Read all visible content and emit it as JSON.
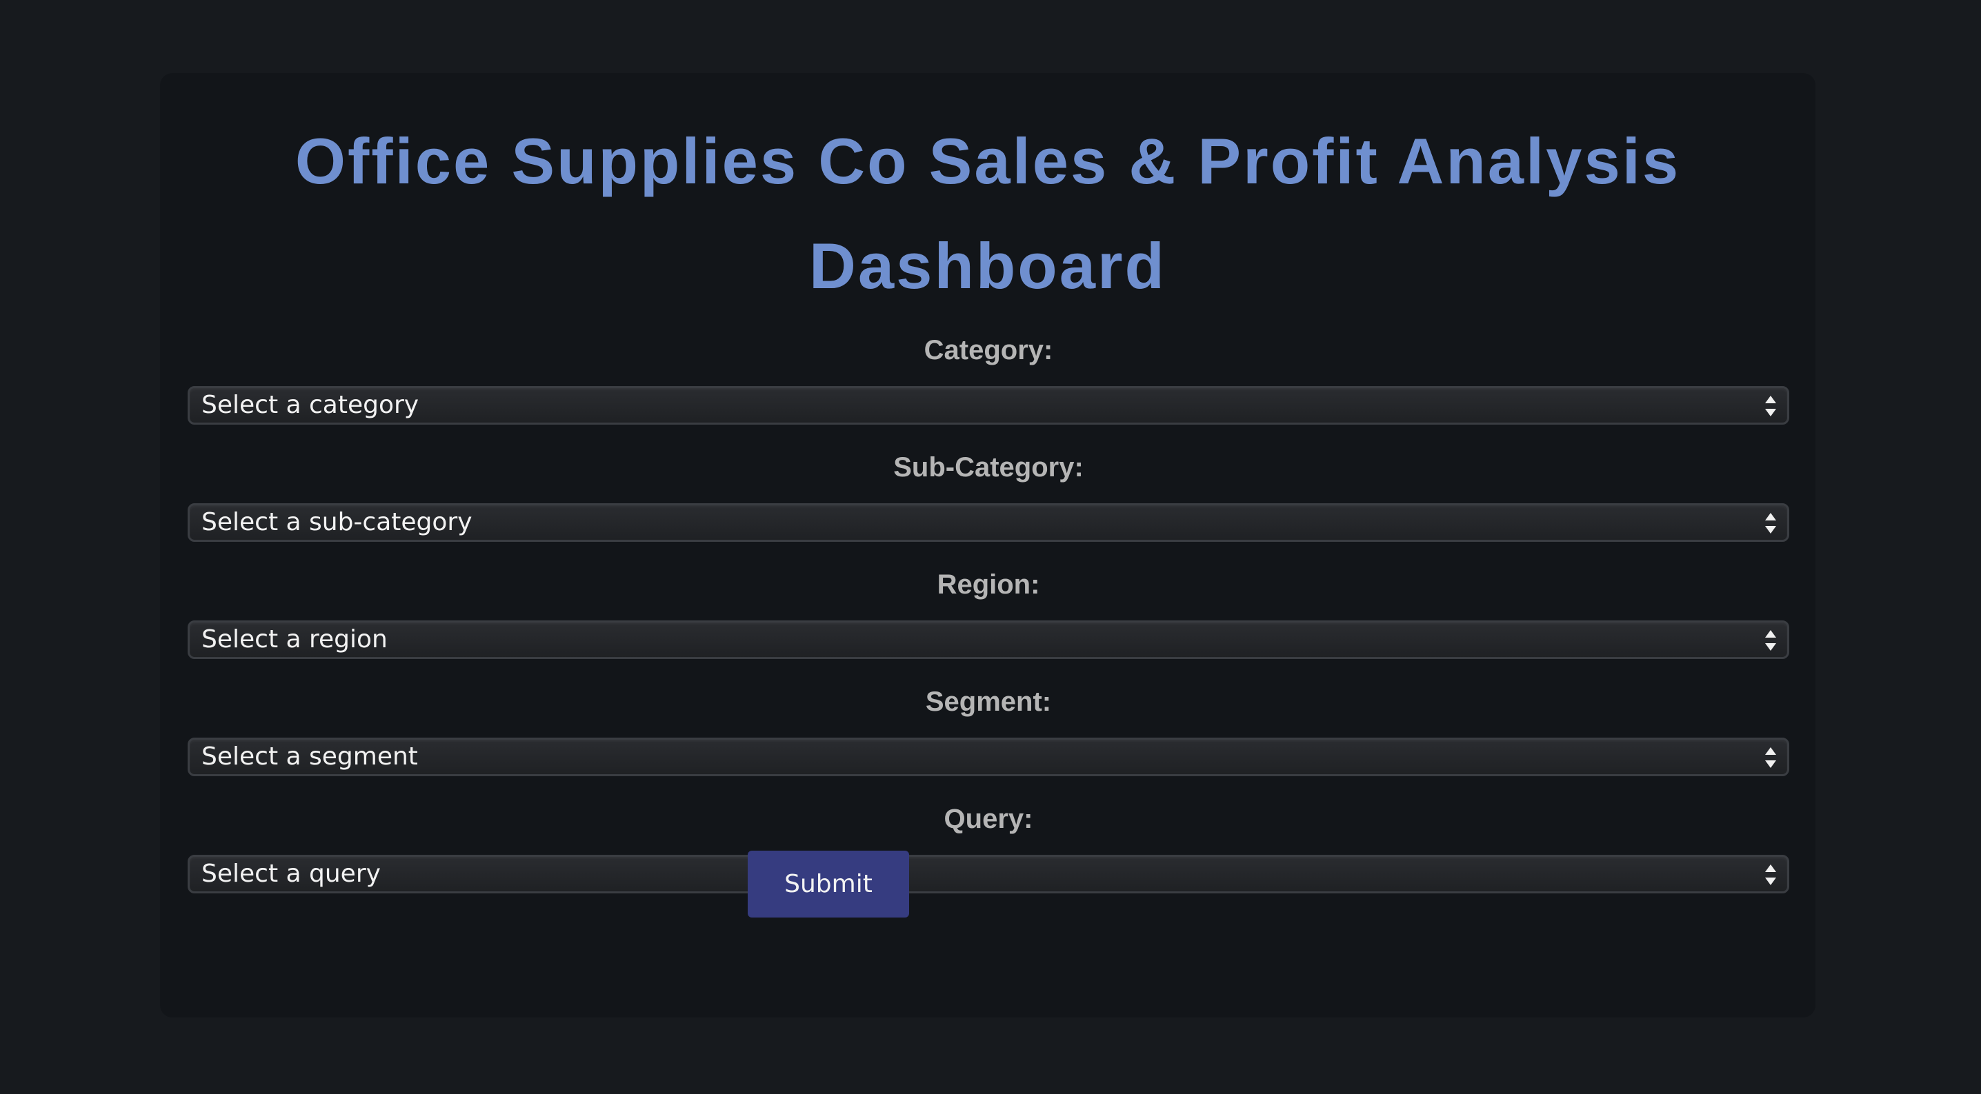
{
  "dashboard": {
    "title": "Office Supplies Co Sales & Profit Analysis Dashboard"
  },
  "filters": [
    {
      "label": "Category:",
      "selected": "Select a category"
    },
    {
      "label": "Sub-Category:",
      "selected": "Select a sub-category"
    },
    {
      "label": "Region:",
      "selected": "Select a region"
    },
    {
      "label": "Segment:",
      "selected": "Select a segment"
    },
    {
      "label": "Query:",
      "selected": "Select a query"
    }
  ],
  "actions": {
    "submit_label": "Submit"
  },
  "colors": {
    "page_background": "#171a1e",
    "panel_background": "#121519",
    "title": "#6f8fcf",
    "label": "#b5b5b5",
    "submit_button": "#363c80"
  },
  "icons": {
    "select_indicator": "up-down-arrows-icon"
  }
}
